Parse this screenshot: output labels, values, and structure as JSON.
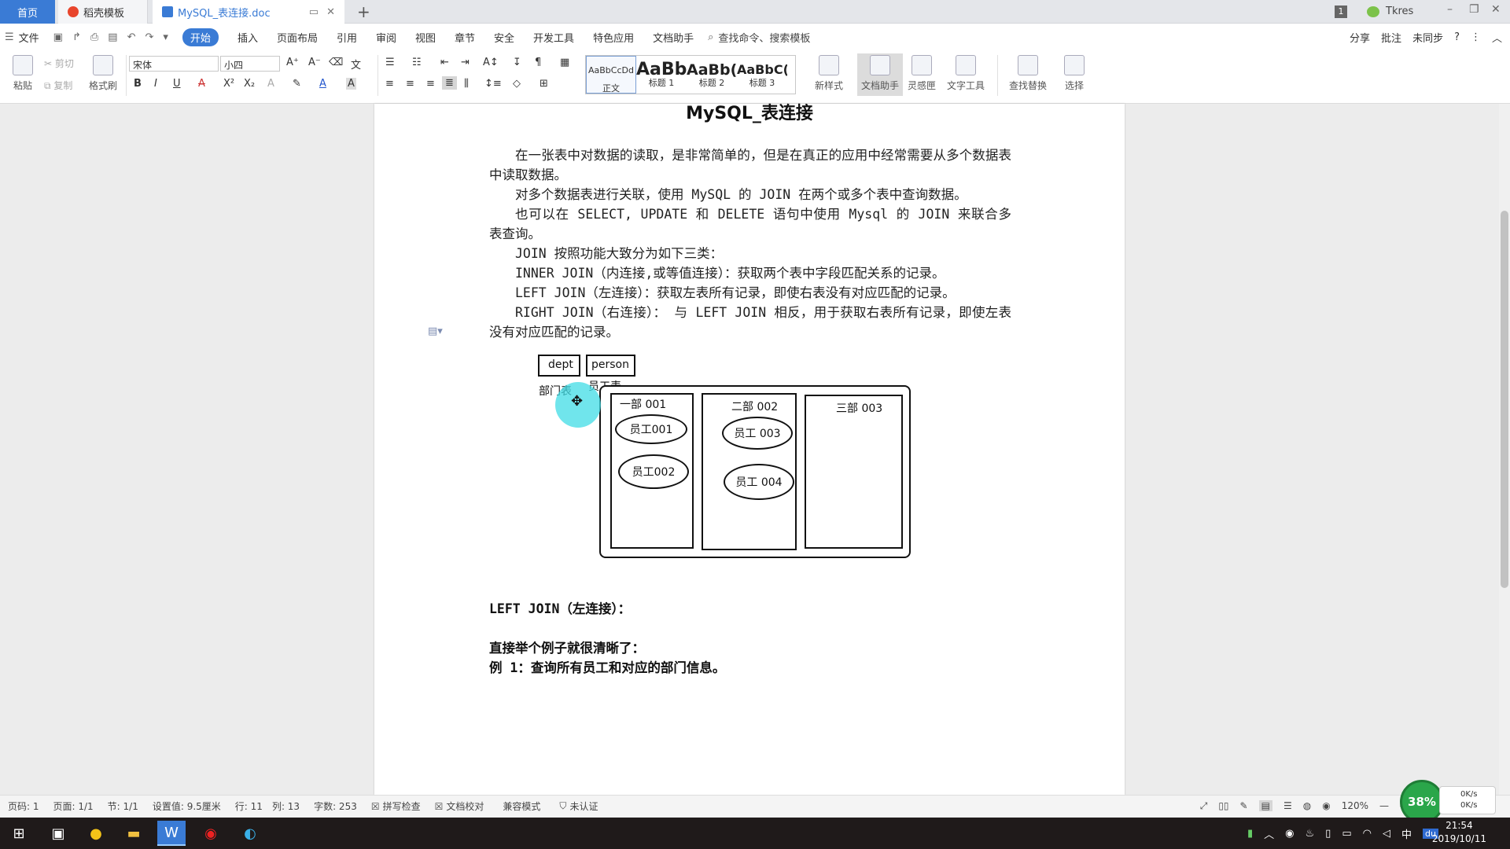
{
  "tabs": [
    {
      "label": "首页"
    },
    {
      "label": "稻壳模板"
    },
    {
      "label": "MySQL_表连接.doc"
    }
  ],
  "header_right": {
    "badge": "1",
    "user": "Tkres"
  },
  "menu": {
    "file": "文件",
    "items": [
      "开始",
      "插入",
      "页面布局",
      "引用",
      "审阅",
      "视图",
      "章节",
      "安全",
      "开发工具",
      "特色应用",
      "文档助手"
    ],
    "search": "查找命令、搜索模板",
    "right": [
      "分享",
      "批注",
      "未同步",
      "?"
    ]
  },
  "ribbon": {
    "paste": "粘贴",
    "cut": "剪切",
    "copy": "复制",
    "format_painter": "格式刷",
    "font_name": "宋体",
    "font_size": "小四",
    "styles": [
      {
        "preview": "AaBbCcDd",
        "label": "正文"
      },
      {
        "preview": "AaBb",
        "label": "标题 1"
      },
      {
        "preview": "AaBb(",
        "label": "标题 2"
      },
      {
        "preview": "AaBbC(",
        "label": "标题 3"
      }
    ],
    "new_style": "新样式",
    "doc_assistant": "文档助手",
    "inspiration": "灵感匣",
    "text_tools": "文字工具",
    "find_replace": "查找替换",
    "select": "选择"
  },
  "document": {
    "title": "MySQL_表连接",
    "paragraphs": [
      "在一张表中对数据的读取，是非常简单的，但是在真正的应用中经常需要从多个数据表中读取数据。",
      "对多个数据表进行关联，使用 MySQL 的 JOIN 在两个或多个表中查询数据。",
      "也可以在 SELECT, UPDATE 和 DELETE 语句中使用 Mysql 的 JOIN 来联合多表查询。",
      "JOIN 按照功能大致分为如下三类：",
      "INNER JOIN（内连接,或等值连接）：获取两个表中字段匹配关系的记录。",
      "LEFT JOIN（左连接）：获取左表所有记录，即使右表没有对应匹配的记录。",
      "RIGHT JOIN（右连接）： 与 LEFT JOIN 相反，用于获取右表所有记录，即使左表没有对应匹配的记录。"
    ],
    "diagram": {
      "table1": "dept",
      "table2": "person",
      "caption1": "部门表",
      "caption2": "员工表",
      "dept1": "一部 001",
      "dept2": "二部 002",
      "dept3": "三部 003",
      "emp1": "员工001",
      "emp2": "员工002",
      "emp3": "员工 003",
      "emp4": "员工 004"
    },
    "heading_left_join": "LEFT JOIN（左连接）：",
    "line_example_intro": "直接举个例子就很清晰了：",
    "line_example1": "例 1：查询所有员工和对应的部门信息。"
  },
  "statusbar": {
    "page_num": "页码: 1",
    "pages": "页面: 1/1",
    "section": "节: 1/1",
    "setting": "设置值: 9.5厘米",
    "row": "行: 11",
    "col": "列: 13",
    "words": "字数: 253",
    "spell": "拼写检查",
    "proof": "文档校对",
    "compat": "兼容模式",
    "cert": "未认证",
    "zoom": "120%"
  },
  "perf": {
    "cpu": "38%",
    "up": "0K/s",
    "down": "0K/s"
  },
  "taskbar": {
    "ime": "中",
    "time": "21:54",
    "date": "2019/10/11"
  }
}
